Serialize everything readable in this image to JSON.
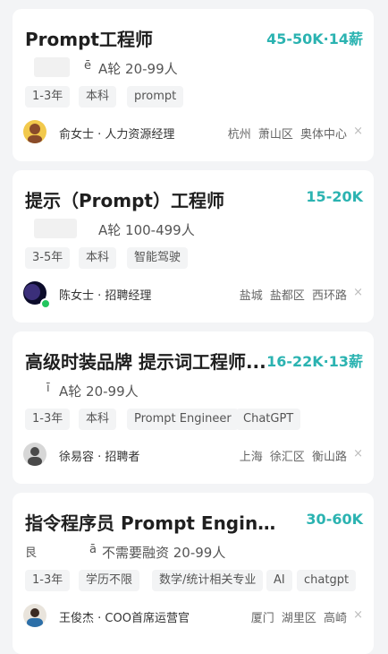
{
  "jobs": [
    {
      "title": "Prompt工程师",
      "salary": "45-50K·14薪",
      "company_fragment": "ē",
      "company_info": "A轮 20-99人",
      "tags": [
        "1-3年",
        "本科",
        "prompt"
      ],
      "recruiter": "俞女士 · 人力资源经理",
      "location": "杭州 萧山区 奥体中心",
      "avatar_colors": [
        "#f2c94c",
        "#8a4b2a"
      ]
    },
    {
      "title": "提示（Prompt）工程师",
      "salary": "15-20K",
      "company_fragment": "",
      "company_info": "A轮 100-499人",
      "tags": [
        "3-5年",
        "本科",
        "智能驾驶"
      ],
      "recruiter": "陈女士 · 招聘经理",
      "location": "盐城 盐都区 西环路",
      "avatar_colors": [
        "#3b2f7a",
        "#0b0b2a"
      ]
    },
    {
      "title": "高级时装品牌 提示词工程师...",
      "salary": "16-22K·13薪",
      "company_fragment": "ī",
      "company_info": "A轮 20-99人",
      "tags": [
        "1-3年",
        "本科",
        "Prompt Engineer",
        "ChatGPT"
      ],
      "recruiter": "徐易容 · 招聘者",
      "location": "上海 徐汇区 衡山路",
      "avatar_colors": [
        "#4a4a4a",
        "#d7d7d7"
      ]
    },
    {
      "title": "指令程序员 Prompt Engineer",
      "salary": "30-60K",
      "company_fragment_a": "艮",
      "company_fragment_b": "ā",
      "company_info": "不需要融资 20-99人",
      "tags": [
        "1-3年",
        "学历不限",
        "数学/统计相关专业",
        "AI",
        "chatgpt"
      ],
      "recruiter": "王俊杰 · COO首席运营官",
      "location": "厦门 湖里区 高崎",
      "avatar_colors": [
        "#2c6fa8",
        "#e9e4dc"
      ]
    }
  ],
  "icons": {
    "close": "×"
  }
}
